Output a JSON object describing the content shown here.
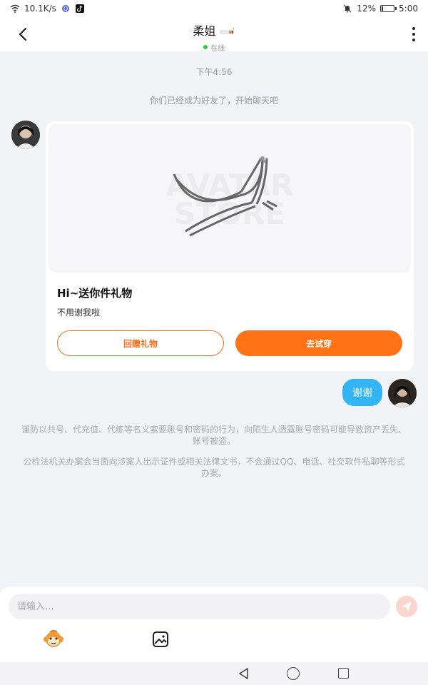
{
  "status_bar": {
    "speed": "10.1K/s",
    "battery_pct": "12%",
    "battery_level": 0.12,
    "time": "5:00"
  },
  "header": {
    "title": "柔姐",
    "status": "在线"
  },
  "chat": {
    "timestamp": "下午4:56",
    "system_message": "你们已经成为好友了，开始聊天吧",
    "gift_card": {
      "title": "Hi~送你件礼物",
      "subtitle": "不用谢我啦",
      "return_button": "回赠礼物",
      "try_button": "去试穿",
      "watermark": "AVATAR STORE"
    },
    "reply_bubble": "谢谢",
    "notices": [
      "谨防以共号、代充值、代练等名义索要账号和密码的行为，向陌生人透露账号密码可能导致资产丢失、账号被盗。",
      "公检法机关办案会当面向涉案人出示证件或相关法律文书，不会通过QQ、电话、社交软件私聊等形式办案。"
    ]
  },
  "input": {
    "placeholder": "请输入..."
  },
  "colors": {
    "accent": "#ff7316",
    "bubble": "#33b5f5",
    "online": "#2ecc40"
  }
}
